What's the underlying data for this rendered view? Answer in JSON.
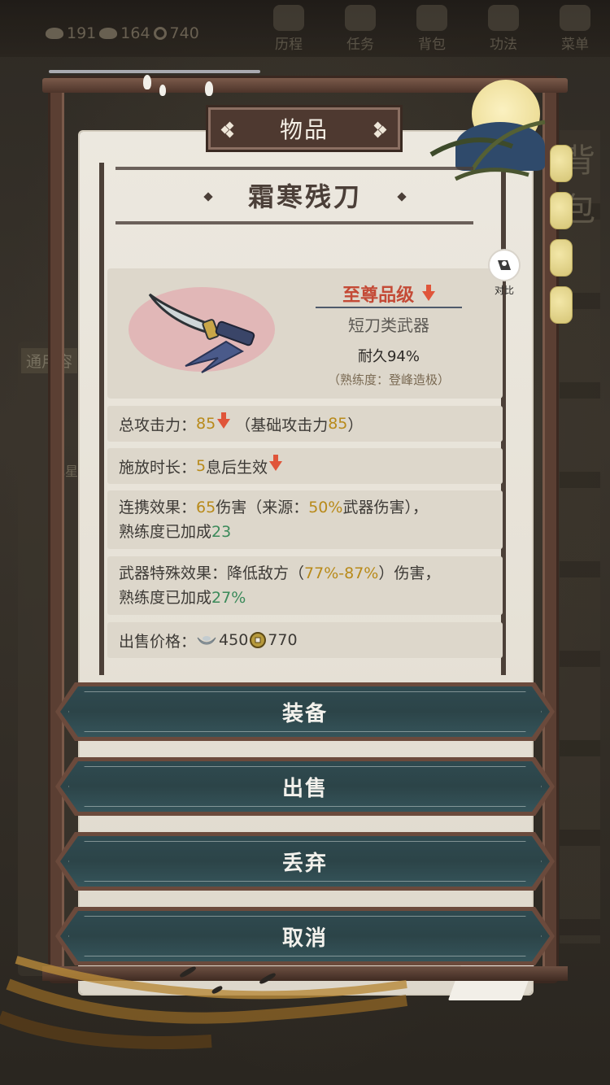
{
  "top_bar": {
    "silver": "191",
    "silver2": "164",
    "copper": "740",
    "nav": [
      {
        "label": "历程",
        "icon": "journey-icon"
      },
      {
        "label": "任务",
        "icon": "task-icon"
      },
      {
        "label": "背包",
        "icon": "bag-icon"
      },
      {
        "label": "功法",
        "icon": "skills-icon"
      },
      {
        "label": "菜单",
        "icon": "menu-fan-icon"
      }
    ]
  },
  "background": {
    "left_tab_label": "通用容",
    "left_item_label": "飞星",
    "right_vertical_text": "背包"
  },
  "dialog": {
    "title": "物品",
    "item_name": "霜寒残刀",
    "grade": "至尊品级",
    "weapon_type": "短刀类武器",
    "durability": "耐久94%",
    "proficiency": "（熟练度：登峰造极）",
    "compare_label": "对比"
  },
  "stats": {
    "attack": {
      "label": "总攻击力：",
      "value": "85",
      "base_prefix": "（基础攻击力",
      "base_value": "85",
      "base_suffix": "）"
    },
    "cast": {
      "label": "施放时长：",
      "value": "5",
      "suffix": "息后生效"
    },
    "combo": {
      "label": "连携效果：",
      "value": "65",
      "mid": "伤害（来源：",
      "percent": "50%",
      "tail": "武器伤害），",
      "line2": "熟练度已加成",
      "bonus": "23"
    },
    "special": {
      "label": "武器特殊效果：降低敌方（",
      "range_low": "77%",
      "dash": "-",
      "range_high": "87%",
      "tail": "）伤害，",
      "line2": "熟练度已加成",
      "bonus": "27%"
    },
    "price": {
      "label": "出售价格：",
      "silver": "450",
      "copper": "770"
    }
  },
  "buttons": {
    "equip": "装备",
    "sell": "出售",
    "discard": "丢弃",
    "cancel": "取消"
  },
  "colors": {
    "accent_gold": "#b88a1a",
    "accent_green": "#3b8a5a",
    "grade_red": "#c44a36",
    "button_teal": "#2f4a50",
    "frame_brown": "#5b3f33"
  }
}
